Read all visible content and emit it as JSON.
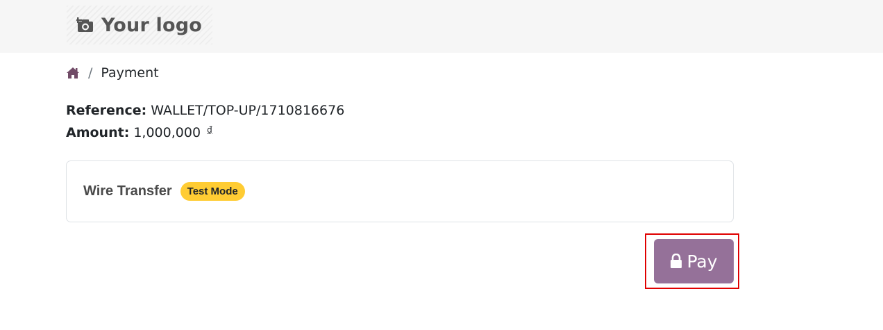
{
  "header": {
    "logo_text": "Your logo",
    "logo_icon": "camera-add-icon"
  },
  "breadcrumb": {
    "home_icon": "home-icon",
    "separator": "/",
    "current": "Payment"
  },
  "payment": {
    "reference_label": "Reference:",
    "reference_value": "WALLET/TOP-UP/1710816676",
    "amount_label": "Amount:",
    "amount_value": "1,000,000",
    "currency_symbol": "₫"
  },
  "method": {
    "name": "Wire Transfer",
    "badge": "Test Mode"
  },
  "actions": {
    "pay_label": "Pay",
    "pay_icon": "lock-icon"
  },
  "colors": {
    "primary": "#957199",
    "home_icon": "#714b67",
    "badge": "#ffcc33",
    "highlight": "#e00000"
  }
}
